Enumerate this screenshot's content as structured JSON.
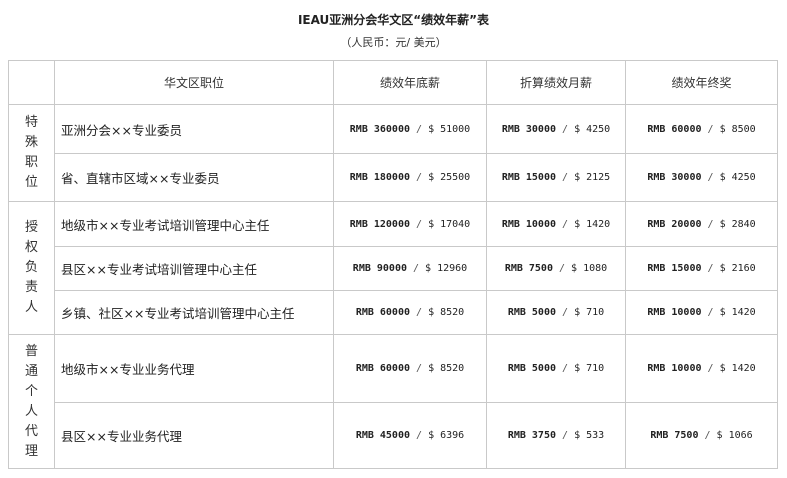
{
  "title": "IEAU亚洲分会华文区“绩效年薪”表",
  "subtitle": "（人民币：元/ 美元）",
  "headers": [
    "华文区职位",
    "绩效年底薪",
    "折算绩效月薪",
    "绩效年终奖"
  ],
  "groups": [
    {
      "category": "特殊职位",
      "rows": [
        {
          "position": "亚洲分会××专业委员",
          "base": {
            "rmb": "RMB 360000",
            "usd": "$ 51000"
          },
          "monthly": {
            "rmb": "RMB 30000",
            "usd": "$ 4250"
          },
          "bonus": {
            "rmb": "RMB 60000",
            "usd": "$ 8500"
          }
        },
        {
          "position": "省、直辖市区域××专业委员",
          "base": {
            "rmb": "RMB 180000",
            "usd": "$ 25500"
          },
          "monthly": {
            "rmb": "RMB 15000",
            "usd": "$ 2125"
          },
          "bonus": {
            "rmb": "RMB 30000",
            "usd": "$ 4250"
          }
        }
      ]
    },
    {
      "category": "授权负责人",
      "rows": [
        {
          "position": "地级市××专业考试培训管理中心主任",
          "base": {
            "rmb": "RMB 120000",
            "usd": "$ 17040"
          },
          "monthly": {
            "rmb": "RMB 10000",
            "usd": "$ 1420"
          },
          "bonus": {
            "rmb": "RMB 20000",
            "usd": "$ 2840"
          }
        },
        {
          "position": "县区××专业考试培训管理中心主任",
          "base": {
            "rmb": "RMB 90000",
            "usd": "$ 12960"
          },
          "monthly": {
            "rmb": "RMB 7500",
            "usd": "$ 1080"
          },
          "bonus": {
            "rmb": "RMB 15000",
            "usd": "$ 2160"
          }
        },
        {
          "position": "乡镇、社区××专业考试培训管理中心主任",
          "base": {
            "rmb": "RMB 60000",
            "usd": "$ 8520"
          },
          "monthly": {
            "rmb": "RMB 5000",
            "usd": "$ 710"
          },
          "bonus": {
            "rmb": "RMB 10000",
            "usd": "$ 1420"
          }
        }
      ]
    },
    {
      "category": "普通个人代理",
      "rows": [
        {
          "position": "地级市××专业业务代理",
          "base": {
            "rmb": "RMB 60000",
            "usd": "$ 8520"
          },
          "monthly": {
            "rmb": "RMB 5000",
            "usd": "$ 710"
          },
          "bonus": {
            "rmb": "RMB 10000",
            "usd": "$ 1420"
          }
        },
        {
          "position": "县区××专业业务代理",
          "base": {
            "rmb": "RMB 45000",
            "usd": "$ 6396"
          },
          "monthly": {
            "rmb": "RMB 3750",
            "usd": "$ 533"
          },
          "bonus": {
            "rmb": "RMB 7500",
            "usd": "$ 1066"
          }
        }
      ]
    }
  ],
  "separator": " / "
}
